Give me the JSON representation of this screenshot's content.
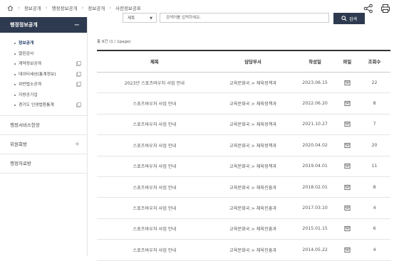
{
  "breadcrumb": {
    "items": [
      "정보공개",
      "행정정보공개",
      "정보공개",
      "사전정보공표"
    ]
  },
  "sidebar": {
    "header": "행정정보공개",
    "header_toggle": "−",
    "items": [
      {
        "label": "정보공개",
        "active": true,
        "ext": false
      },
      {
        "label": "열린감사",
        "active": false,
        "ext": false
      },
      {
        "label": "계약정보공개",
        "active": false,
        "ext": true
      },
      {
        "label": "데이터세상(통계정보)",
        "active": false,
        "ext": true
      },
      {
        "label": "위반법소공개",
        "active": false,
        "ext": true
      },
      {
        "label": "지방공기업",
        "active": false,
        "ext": false
      },
      {
        "label": "경기도 인생법환통계",
        "active": false,
        "ext": true
      }
    ],
    "menus": [
      {
        "label": "행정서비스헌장",
        "plus": ""
      },
      {
        "label": "위원회방",
        "plus": "+"
      },
      {
        "label": "행정자료방",
        "plus": ""
      }
    ]
  },
  "search": {
    "select_value": "제목",
    "placeholder": "검색어를 입력하세요.",
    "button_label": "검색"
  },
  "list": {
    "count_text": "총 9건 (1 / 1page)",
    "headers": [
      "제목",
      "담당부서",
      "작성일",
      "파일",
      "조회수"
    ],
    "rows": [
      [
        "2023년 스포츠바우처 사업 안내",
        "교육문화국 > 체육정책과",
        "2023.06.15",
        "22"
      ],
      [
        "스포츠바우처 사업 안내",
        "교육문화국 > 체육정책과",
        "2022.06.20",
        "8"
      ],
      [
        "스포츠바우처 사업 안내",
        "교육문화국 > 체육정책과",
        "2021.10.27",
        "7"
      ],
      [
        "스포츠바우처 사업 안내",
        "교육문화국 > 체육정책과",
        "2020.04.02",
        "20"
      ],
      [
        "스포츠바우처 사업 안내",
        "교육문화국 > 체육정책과",
        "2019.04.01",
        "11"
      ],
      [
        "스포츠바우처 사업 안내",
        "교육문화국 > 체육진흥과",
        "2018.02.01",
        "8"
      ],
      [
        "스포츠바우처 사업 안내",
        "교육문화국 > 체육진흥과",
        "2017.03.10",
        "4"
      ],
      [
        "스포츠바우처 사업 안내",
        "교육문화국 > 체육진흥과",
        "2015.01.15",
        "6"
      ],
      [
        "스포츠바우처 사업 안내",
        "교육문화국 > 체육진흥과",
        "2014.05.22",
        "4"
      ]
    ]
  }
}
